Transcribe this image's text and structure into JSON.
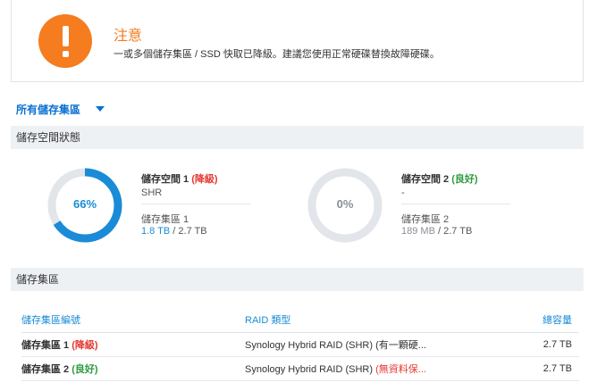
{
  "alert": {
    "title": "注意",
    "message": "一或多個儲存集區 / SSD 快取已降級。建議您使用正常硬碟替換故障硬碟。",
    "icon": "exclamation-icon",
    "accent": "#f57c1f"
  },
  "scope_selector": {
    "label": "所有儲存集區"
  },
  "sections": {
    "storage_status": "儲存空間狀態",
    "storage_pools": "儲存集區"
  },
  "volumes": [
    {
      "name": "儲存空間 1",
      "status_open": "(",
      "status": "降級",
      "status_close": ")",
      "type": "SHR",
      "usage_percent": 66,
      "usage_label": "66%",
      "pool": "儲存集區 1",
      "used": "1.8 TB",
      "total": "/ 2.7 TB",
      "ring_color": "#1a8bd6"
    },
    {
      "name": "儲存空間 2",
      "status_open": "(",
      "status": "良好",
      "status_close": ")",
      "type": "-",
      "usage_percent": 0,
      "usage_label": "0%",
      "pool": "儲存集區 2",
      "used": "189 MB",
      "total": "/ 2.7 TB",
      "ring_color": "#e2e5e9"
    }
  ],
  "pool_table": {
    "headers": {
      "name": "儲存集區編號",
      "raid": "RAID 類型",
      "capacity": "總容量"
    },
    "rows": [
      {
        "name": "儲存集區 1",
        "status_open": "(",
        "status": "降級",
        "status_close": ")",
        "raid": "Synology Hybrid RAID (SHR)",
        "raid_note": "(有一顆硬...",
        "capacity": "2.7 TB"
      },
      {
        "name": "儲存集區 2",
        "status_open": "(",
        "status": "良好",
        "status_close": ")",
        "raid": "Synology Hybrid RAID (SHR)",
        "raid_note": "(無資料保...",
        "capacity": "2.7 TB"
      }
    ]
  }
}
